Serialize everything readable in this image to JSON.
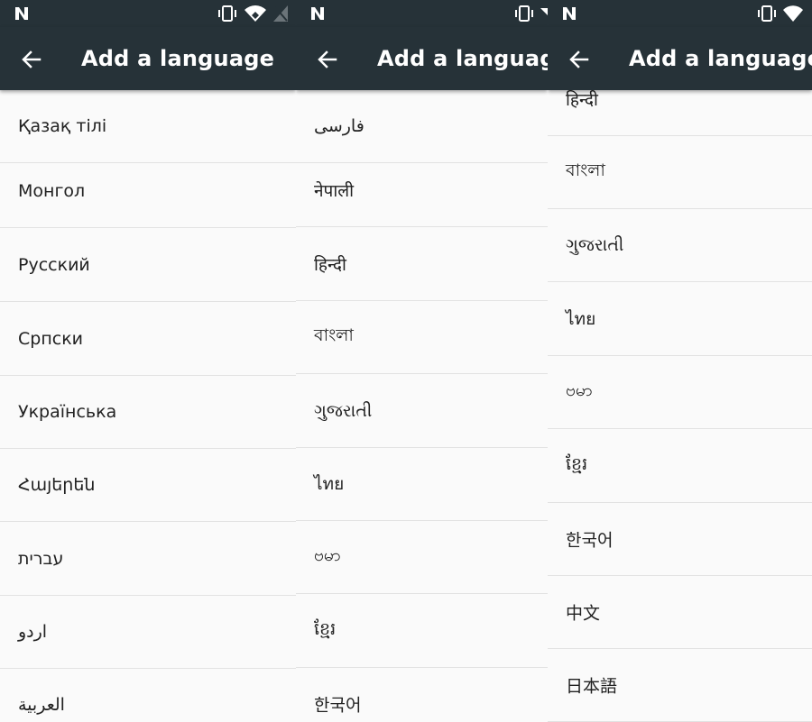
{
  "screens": [
    {
      "title": "Add a language",
      "items": [
        "Қазақ тілі",
        "Монгол",
        "Русский",
        "Српски",
        "Українська",
        "Հայերեն",
        "עברית",
        "اردو",
        "العربية"
      ]
    },
    {
      "title": "Add a language",
      "items": [
        "فارسی",
        "नेपाली",
        "हिन्दी",
        "বাংলা",
        "ગુજરાતી",
        "ไทย",
        "ဗမာ",
        "ខ្មែរ",
        "한국어"
      ]
    },
    {
      "title": "Add a language",
      "items": [
        "हिन्दी",
        "বাংলা",
        "ગુજરાતી",
        "ไทย",
        "ဗမာ",
        "ខ្មែរ",
        "한국어",
        "中文",
        "日本語"
      ]
    }
  ],
  "icons": {
    "status_left": "n-notification-icon",
    "vibrate": "vibrate-icon",
    "wifi": "wifi-icon",
    "signal": "no-signal-icon",
    "back": "back-arrow-icon"
  },
  "colors": {
    "toolbar": "#263238",
    "list_background": "#fafafa",
    "divider": "#e2e2e2",
    "text": "#212121",
    "title_text": "#ffffff"
  }
}
